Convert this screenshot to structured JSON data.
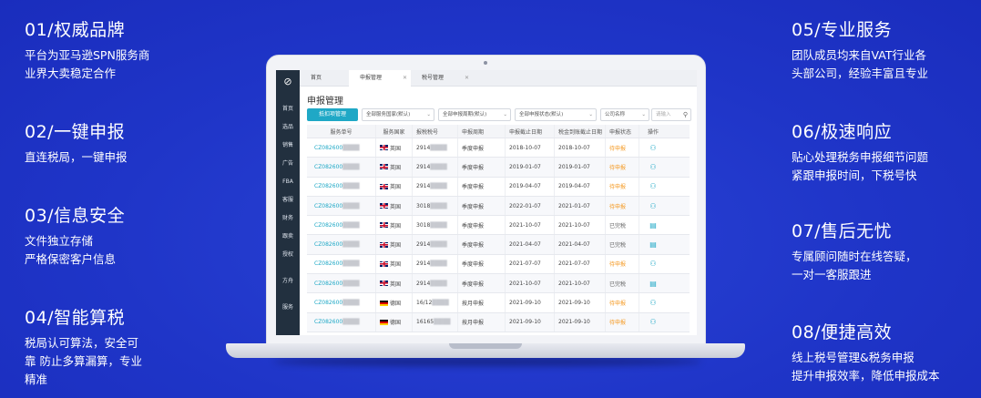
{
  "features": [
    {
      "title": "01/权威品牌",
      "lines": [
        "平台为亚马逊SPN服务商",
        "业界大卖稳定合作"
      ]
    },
    {
      "title": "02/一键申报",
      "lines": [
        "直连税局，一键申报"
      ]
    },
    {
      "title": "03/信息安全",
      "lines": [
        "文件独立存储",
        "严格保密客户信息"
      ]
    },
    {
      "title": "04/智能算税",
      "lines": [
        "税局认可算法，安全可",
        "靠 防止多算漏算，专业",
        "精准"
      ]
    },
    {
      "title": "05/专业服务",
      "lines": [
        "团队成员均来自VAT行业各",
        "头部公司，经验丰富且专业"
      ]
    },
    {
      "title": "06/极速响应",
      "lines": [
        "贴心处理税务申报细节问题",
        "紧跟申报时间，下税号快"
      ]
    },
    {
      "title": "07/售后无忧",
      "lines": [
        "专属顾问随时在线答疑，",
        "一对一客服跟进"
      ]
    },
    {
      "title": "08/便捷高效",
      "lines": [
        "线上税号管理&税务申报",
        "提升申报效率，降低申报成本"
      ]
    }
  ],
  "app": {
    "logo": "⊘",
    "sidebar": [
      "首页",
      "选品",
      "销售",
      "广告",
      "FBA",
      "客服",
      "财务",
      "跟卖",
      "授权",
      "方舟",
      "服务"
    ],
    "tabs": [
      {
        "label": "首页"
      },
      {
        "label": "申报管理"
      },
      {
        "label": "税号管理"
      }
    ],
    "page_title": "申报管理",
    "toolbar": {
      "primary_button": "抵扣项管理",
      "filters": [
        "全部服务国家(默认)",
        "全部申报周期(默认)",
        "全部申报状态(默认)",
        "公司名称"
      ],
      "search_placeholder": "请输入"
    },
    "columns": [
      "服务单号",
      "服务国家",
      "报税税号",
      "申报周期",
      "申报截止日期",
      "税金到账截止日期",
      "申报状态",
      "操作"
    ],
    "rows": [
      {
        "id": "CZ082600",
        "country": "英国",
        "flag": "uk",
        "tax_no": "2914",
        "period": "季度申报",
        "deadline": "2018-10-07",
        "pay_deadline": "2018-10-07",
        "status": "待申报",
        "status_type": "pending",
        "op": "user-icon"
      },
      {
        "id": "CZ082600",
        "country": "英国",
        "flag": "uk",
        "tax_no": "2914",
        "period": "季度申报",
        "deadline": "2019-01-07",
        "pay_deadline": "2019-01-07",
        "status": "待申报",
        "status_type": "pending",
        "op": "user-icon"
      },
      {
        "id": "CZ082600",
        "country": "英国",
        "flag": "uk",
        "tax_no": "2914",
        "period": "季度申报",
        "deadline": "2019-04-07",
        "pay_deadline": "2019-04-07",
        "status": "待申报",
        "status_type": "pending",
        "op": "user-icon"
      },
      {
        "id": "CZ082600",
        "country": "英国",
        "flag": "uk",
        "tax_no": "3018",
        "period": "季度申报",
        "deadline": "2022-01-07",
        "pay_deadline": "2021-01-07",
        "status": "待申报",
        "status_type": "pending",
        "op": "user-icon"
      },
      {
        "id": "CZ082600",
        "country": "英国",
        "flag": "uk",
        "tax_no": "3018",
        "period": "季度申报",
        "deadline": "2021-10-07",
        "pay_deadline": "2021-10-07",
        "status": "已完税",
        "status_type": "done",
        "op": "doc-icon"
      },
      {
        "id": "CZ082600",
        "country": "英国",
        "flag": "uk",
        "tax_no": "2914",
        "period": "季度申报",
        "deadline": "2021-04-07",
        "pay_deadline": "2021-04-07",
        "status": "已完税",
        "status_type": "done",
        "op": "doc-icon"
      },
      {
        "id": "CZ082600",
        "country": "英国",
        "flag": "uk",
        "tax_no": "2914",
        "period": "季度申报",
        "deadline": "2021-07-07",
        "pay_deadline": "2021-07-07",
        "status": "待申报",
        "status_type": "pending",
        "op": "user-icon"
      },
      {
        "id": "CZ082600",
        "country": "英国",
        "flag": "uk",
        "tax_no": "2914",
        "period": "季度申报",
        "deadline": "2021-10-07",
        "pay_deadline": "2021-10-07",
        "status": "已完税",
        "status_type": "done",
        "op": "doc-icon"
      },
      {
        "id": "CZ082600",
        "country": "德国",
        "flag": "de",
        "tax_no": "16/12",
        "period": "按月申报",
        "deadline": "2021-09-10",
        "pay_deadline": "2021-09-10",
        "status": "待申报",
        "status_type": "pending",
        "op": "user-icon"
      },
      {
        "id": "CZ082600",
        "country": "德国",
        "flag": "de",
        "tax_no": "16165",
        "period": "按月申报",
        "deadline": "2021-09-10",
        "pay_deadline": "2021-09-10",
        "status": "待申报",
        "status_type": "pending",
        "op": "user-icon"
      }
    ]
  },
  "colors": {
    "background": "#1f35c8",
    "accent": "#1fa8c6",
    "pending": "#f59a23",
    "sidebar": "#22303f"
  }
}
